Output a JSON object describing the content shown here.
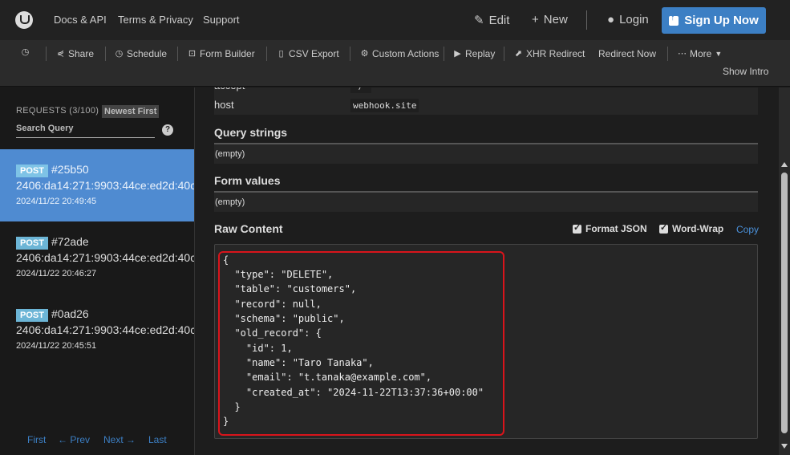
{
  "header": {
    "nav": [
      "Docs & API",
      "Terms & Privacy",
      "Support"
    ],
    "edit_label": "Edit",
    "new_label": "New",
    "login_label": "Login",
    "signup_label": "Sign Up Now"
  },
  "toolbar": {
    "share": "Share",
    "schedule": "Schedule",
    "form_builder": "Form Builder",
    "csv_export": "CSV Export",
    "custom_actions": "Custom Actions",
    "replay": "Replay",
    "xhr_redirect": "XHR Redirect",
    "redirect_now": "Redirect Now",
    "more": "More",
    "show_intro": "Show Intro"
  },
  "sidebar": {
    "requests_label": "REQUESTS (3/100)",
    "sort_label": "Newest First",
    "search_placeholder": "Search Query",
    "help": "?",
    "requests": [
      {
        "method": "POST",
        "id": "#25b50",
        "ip": "2406:da14:271:9903:44ce:ed2d:40c",
        "date": "2024/11/22 20:49:45"
      },
      {
        "method": "POST",
        "id": "#72ade",
        "ip": "2406:da14:271:9903:44ce:ed2d:40c",
        "date": "2024/11/22 20:46:27"
      },
      {
        "method": "POST",
        "id": "#0ad26",
        "ip": "2406:da14:271:9903:44ce:ed2d:40c",
        "date": "2024/11/22 20:45:51"
      }
    ],
    "pager": {
      "first": "First",
      "prev": "← Prev",
      "next": "Next →",
      "last": "Last"
    }
  },
  "main": {
    "partial_key": "accept",
    "partial_value": "*/*",
    "host_key": "host",
    "host_value": "webhook.site",
    "query_title": "Query strings",
    "query_value": "(empty)",
    "form_title": "Form values",
    "form_value": "(empty)",
    "raw_title": "Raw Content",
    "format_json": "Format JSON",
    "word_wrap": "Word-Wrap",
    "copy": "Copy",
    "raw_lines": [
      "{",
      "  \"type\": \"DELETE\",",
      "  \"table\": \"customers\",",
      "  \"record\": null,",
      "  \"schema\": \"public\",",
      "  \"old_record\": {",
      "    \"id\": 1,",
      "    \"name\": \"Taro Tanaka\",",
      "    \"email\": \"t.tanaka@example.com\",",
      "    \"created_at\": \"2024-11-22T13:37:36+00:00\"",
      "  }",
      "}"
    ]
  },
  "colors": {
    "accent": "#3c7fc4",
    "active_request": "#4f8bd1",
    "highlight": "#d9141b"
  }
}
